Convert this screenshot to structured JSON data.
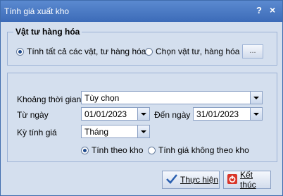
{
  "window": {
    "title": "Tính giá xuất kho",
    "help": "?",
    "close": "×"
  },
  "group_vattu": {
    "title": "Vật tư hàng hóa",
    "opt_all": "Tính tất cả các vật, tư hàng hóa",
    "opt_select": "Chọn vật tư, hàng hóa",
    "browse": "..."
  },
  "form": {
    "period_label": "Khoảng thời gian",
    "period_value": "Tùy chọn",
    "from_label": "Từ ngày",
    "from_value": "01/01/2023",
    "to_label": "Đến ngày",
    "to_value": "31/01/2023",
    "cycle_label": "Kỳ tính giá",
    "cycle_value": "Tháng",
    "opt_by_warehouse": "Tính theo kho",
    "opt_not_by_warehouse": "Tính giá không theo kho"
  },
  "buttons": {
    "run": "Thực hiện",
    "finish": "Kết thúc"
  },
  "colors": {
    "titlebar": "#3c6bb8",
    "panel": "#d4dfee"
  }
}
